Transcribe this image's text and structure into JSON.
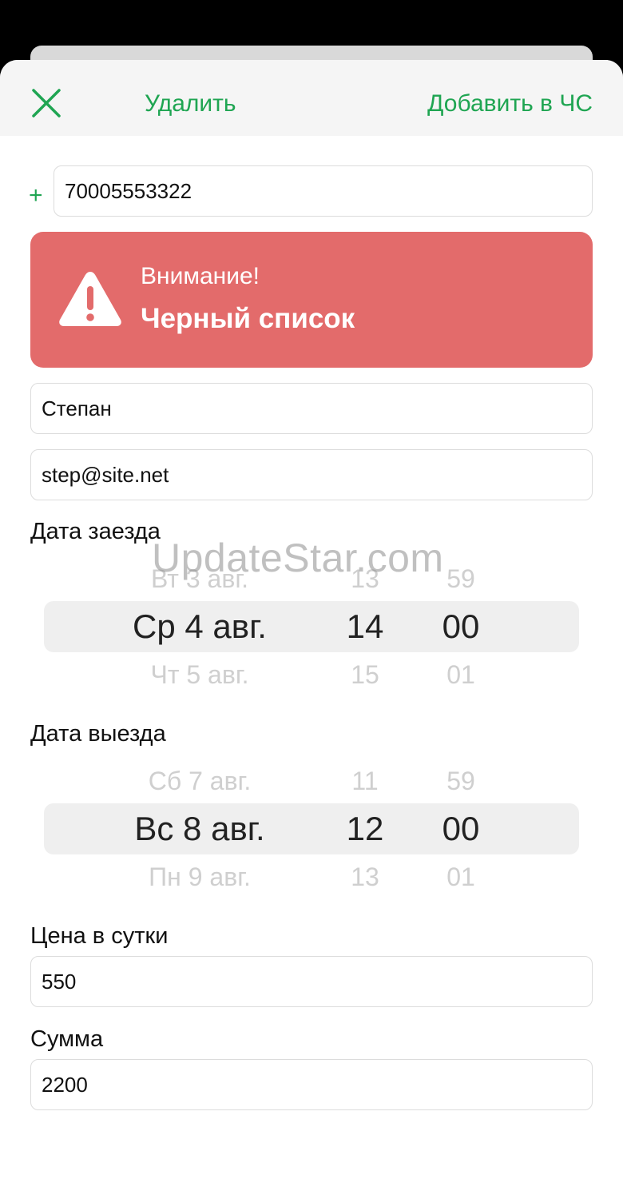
{
  "navbar": {
    "delete_label": "Удалить",
    "blacklist_label": "Добавить в ЧС",
    "close_icon": "close-icon"
  },
  "phone": {
    "prefix": "+",
    "value": "70005553322"
  },
  "alert": {
    "subtitle": "Внимание!",
    "title": "Черный список",
    "icon": "warning-icon",
    "color": "#e36b6b"
  },
  "guest": {
    "name": "Степан",
    "email": "step@site.net"
  },
  "checkin": {
    "label": "Дата заезда",
    "prev": {
      "date": "Вт 3 авг.",
      "hour": "13",
      "minute": "59"
    },
    "selected": {
      "date": "Ср 4 авг.",
      "hour": "14",
      "minute": "00"
    },
    "next": {
      "date": "Чт 5 авг.",
      "hour": "15",
      "minute": "01"
    }
  },
  "checkout": {
    "label": "Дата выезда",
    "prev": {
      "date": "Сб 7 авг.",
      "hour": "11",
      "minute": "59"
    },
    "selected": {
      "date": "Вс 8 авг.",
      "hour": "12",
      "minute": "00"
    },
    "next": {
      "date": "Пн 9 авг.",
      "hour": "13",
      "minute": "01"
    }
  },
  "price": {
    "label": "Цена в сутки",
    "value": "550"
  },
  "total": {
    "label": "Сумма",
    "value": "2200"
  },
  "watermark": "UpdateStar.com",
  "accent_color": "#1fa552"
}
